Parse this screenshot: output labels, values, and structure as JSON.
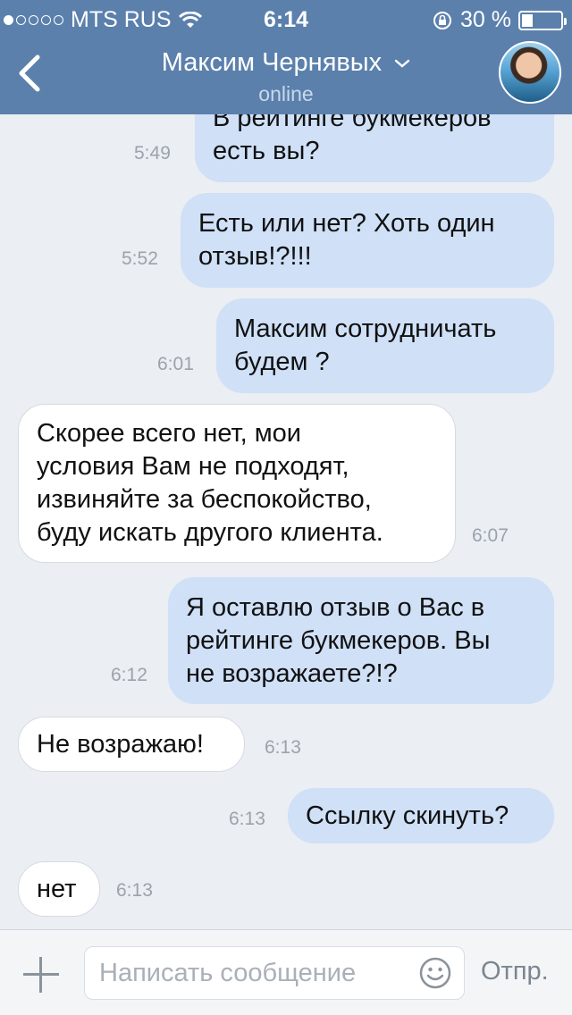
{
  "status": {
    "carrier": "MTS RUS",
    "time": "6:14",
    "battery": "30 %"
  },
  "header": {
    "title": "Максим Чернявых",
    "subtitle": "online"
  },
  "messages": [
    {
      "dir": "out",
      "text": "В рейтинге букмекеров\nесть вы?",
      "time": "5:49"
    },
    {
      "dir": "out",
      "text": "Есть или нет?  Хоть один\nотзыв!?!!!",
      "time": "5:52"
    },
    {
      "dir": "out",
      "text": "Максим сотрудничать\nбудем ?",
      "time": "6:01"
    },
    {
      "dir": "in",
      "text": "Скорее всего нет, мои\nусловия Вам не подходят,\nизвиняйте за беспокойство,\nбуду искать другого клиента.",
      "time": "6:07"
    },
    {
      "dir": "out",
      "text": "Я оставлю отзыв о Вас в\nрейтинге букмекеров. Вы\nне возражаете?!?",
      "time": "6:12"
    },
    {
      "dir": "in",
      "text": "Не возражаю!",
      "time": "6:13"
    },
    {
      "dir": "out",
      "text": "Ссылку скинуть?",
      "time": "6:13"
    },
    {
      "dir": "in",
      "text": "нет",
      "time": "6:13"
    }
  ],
  "composer": {
    "placeholder": "Написать сообщение",
    "send_label": "Отпр."
  },
  "colors": {
    "header_bg": "#5b80ac",
    "outgoing_bubble": "#cfe0f7",
    "incoming_bubble": "#ffffff",
    "chat_bg": "#ebeef2"
  }
}
